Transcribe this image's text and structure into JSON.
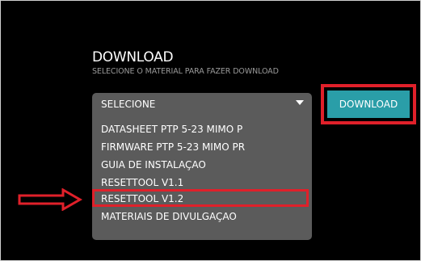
{
  "download": {
    "title": "DOWNLOAD",
    "subtitle": "SELECIONE O MATERIAL PARA FAZER DOWNLOAD",
    "button_label": "DOWNLOAD"
  },
  "select": {
    "selected": "SELECIONE",
    "options": [
      "DATASHEET PTP 5-23 MIMO P",
      "FIRMWARE PTP 5-23 MIMO PR",
      "GUIA DE INSTALAÇAO",
      "RESETTOOL V1.1",
      "RESETTOOL V1.2",
      "MATERIAIS DE DIVULGAÇAO"
    ],
    "highlighted_option": "RESETTOOL V1.2"
  },
  "colors": {
    "background": "#000000",
    "dropdown": "#5b5b5b",
    "button": "#2a9ea8",
    "annotation": "#e0202a",
    "subtitle": "#9a9a9a"
  },
  "icons": {
    "caret": "caret-down-icon",
    "annotation_arrow": "right-arrow-icon"
  }
}
